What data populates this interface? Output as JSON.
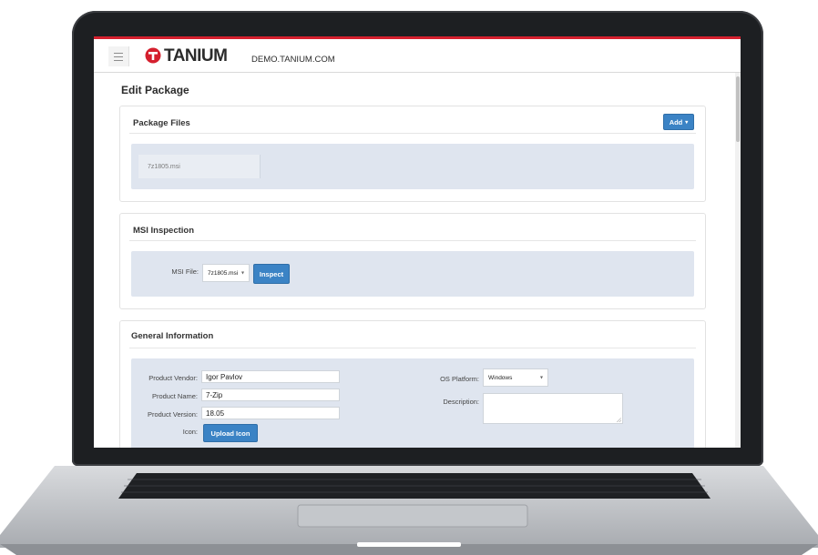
{
  "app": {
    "brand": "TANIUM",
    "domain": "DEMO.TANIUM.COM",
    "page_title": "Edit Package"
  },
  "package_files": {
    "title": "Package Files",
    "add_label": "Add",
    "files": [
      "7z1805.msi"
    ]
  },
  "msi_inspection": {
    "title": "MSI Inspection",
    "file_label": "MSI File:",
    "selected_file": "7z1805.msi",
    "inspect_label": "Inspect"
  },
  "general": {
    "title": "General Information",
    "vendor_label": "Product Vendor:",
    "vendor_value": "Igor Pavlov",
    "name_label": "Product Name:",
    "name_value": "7-Zip",
    "version_label": "Product Version:",
    "version_value": "18.05",
    "icon_label": "Icon:",
    "upload_label": "Upload Icon",
    "os_label": "OS Platform:",
    "os_value": "Windows",
    "description_label": "Description:"
  },
  "colors": {
    "accent": "#3b83c5",
    "brand_red": "#d5202e",
    "well": "#dfe5ef"
  },
  "icons": [
    "menu-icon",
    "tanium-logo-icon",
    "caret-down-icon"
  ]
}
